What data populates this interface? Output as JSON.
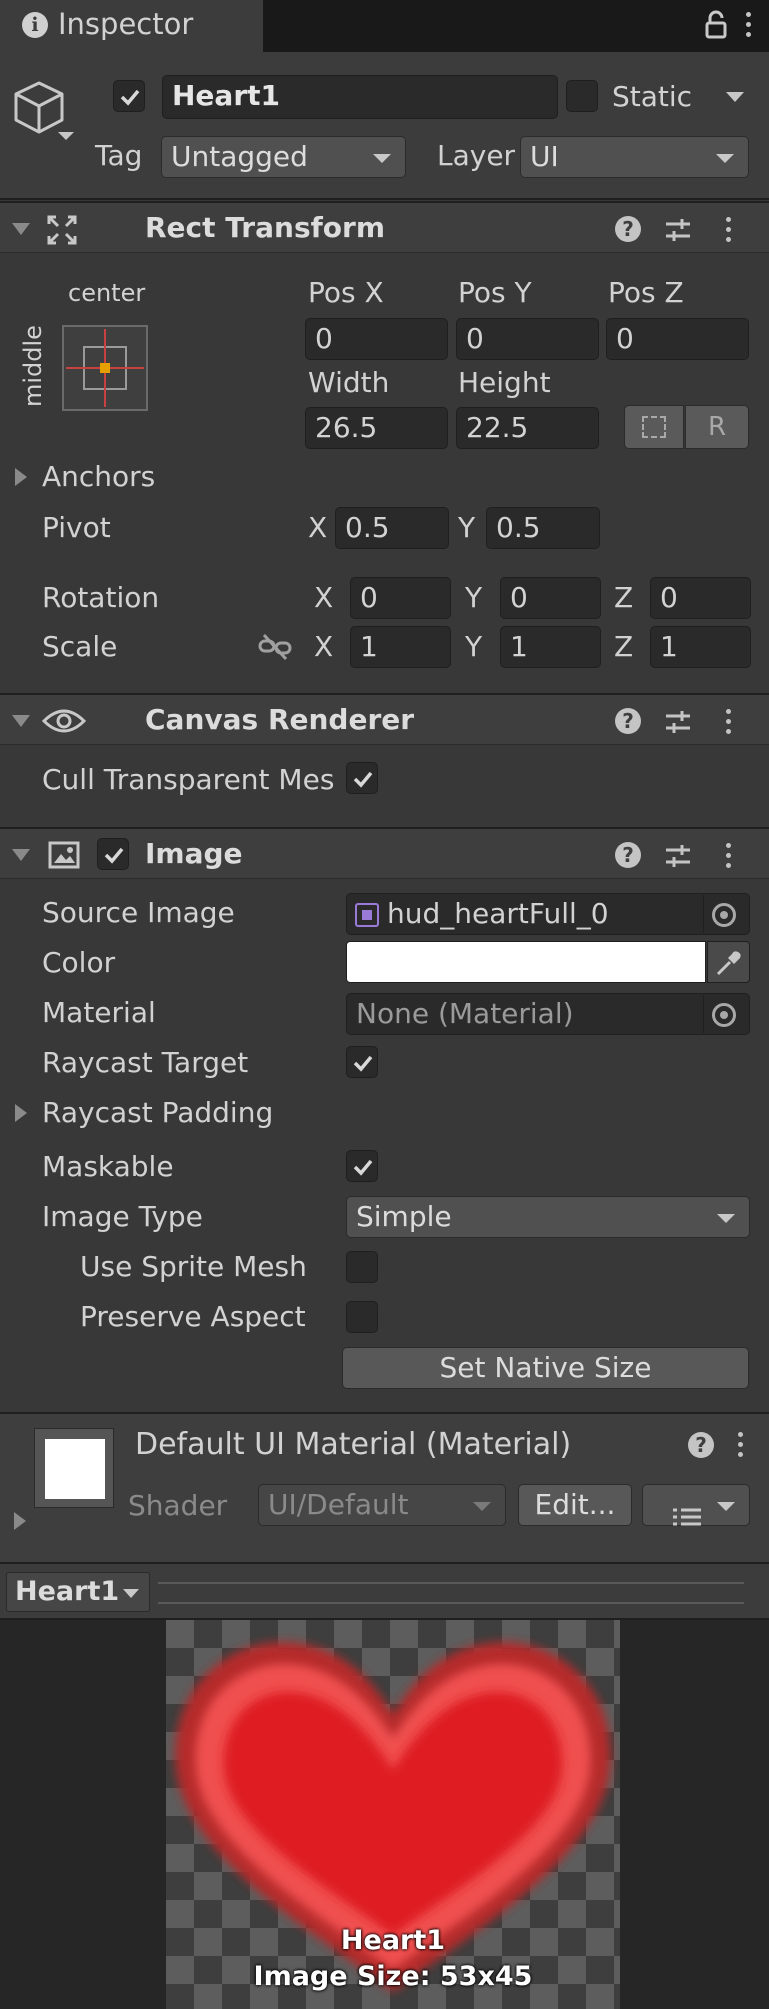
{
  "tab": {
    "title": "Inspector"
  },
  "object": {
    "name": "Heart1",
    "static_label": "Static",
    "tag_label": "Tag",
    "tag_value": "Untagged",
    "layer_label": "Layer",
    "layer_value": "UI"
  },
  "rect_transform": {
    "title": "Rect Transform",
    "anchor_h": "center",
    "anchor_v": "middle",
    "pos_x_label": "Pos X",
    "pos_y_label": "Pos Y",
    "pos_z_label": "Pos Z",
    "pos_x": "0",
    "pos_y": "0",
    "pos_z": "0",
    "width_label": "Width",
    "height_label": "Height",
    "width": "26.5",
    "height": "22.5",
    "r_button": "R",
    "anchors_label": "Anchors",
    "pivot_label": "Pivot",
    "pivot_x_label": "X",
    "pivot_y_label": "Y",
    "pivot_x": "0.5",
    "pivot_y": "0.5",
    "rotation_label": "Rotation",
    "rot_x": "0",
    "rot_y": "0",
    "rot_z": "0",
    "scale_label": "Scale",
    "scale_x": "1",
    "scale_y": "1",
    "scale_z": "1",
    "x_label": "X",
    "y_label": "Y",
    "z_label": "Z"
  },
  "canvas_renderer": {
    "title": "Canvas Renderer",
    "cull_label": "Cull Transparent Mes"
  },
  "image": {
    "title": "Image",
    "source_image_label": "Source Image",
    "source_image_value": "hud_heartFull_0",
    "color_label": "Color",
    "color_value": "#ffffff",
    "material_label": "Material",
    "material_value": "None (Material)",
    "raycast_target_label": "Raycast Target",
    "raycast_padding_label": "Raycast Padding",
    "maskable_label": "Maskable",
    "image_type_label": "Image Type",
    "image_type_value": "Simple",
    "use_sprite_mesh_label": "Use Sprite Mesh",
    "preserve_aspect_label": "Preserve Aspect",
    "set_native_size": "Set Native Size"
  },
  "material": {
    "title": "Default UI Material (Material)",
    "shader_label": "Shader",
    "shader_value": "UI/Default",
    "edit_button": "Edit..."
  },
  "preview": {
    "dropdown": "Heart1",
    "caption_name": "Heart1",
    "caption_size": "Image Size: 53x45"
  },
  "colors": {
    "heart": "#e02020",
    "accent_anchor": "#e5a000"
  }
}
